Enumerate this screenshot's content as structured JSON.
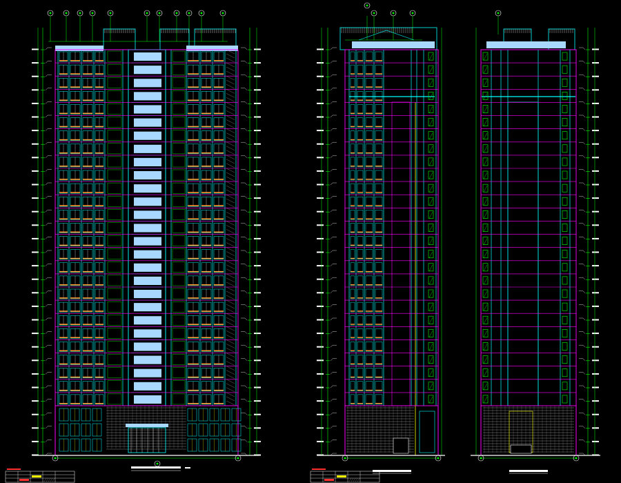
{
  "drawing": {
    "background": "#000000",
    "colors": {
      "magenta": "#ff00ff",
      "cyan": "#00ffff",
      "green": "#00ff00",
      "yellow": "#ffff00",
      "white": "#ffffff",
      "lightblue": "#a8d8ff",
      "orange": "#ff9933",
      "red": "#ff3030",
      "grey": "#8a8a8a"
    },
    "elevations": [
      {
        "id": "front",
        "floors": 27,
        "axis_bubbles": 11,
        "podium_floors": 3
      },
      {
        "id": "side-left",
        "floors": 27,
        "axis_bubbles": 3,
        "podium_floors": 3
      },
      {
        "id": "side-right",
        "floors": 27,
        "axis_bubbles": 1,
        "podium_floors": 3
      }
    ],
    "legend_tables": 2
  }
}
